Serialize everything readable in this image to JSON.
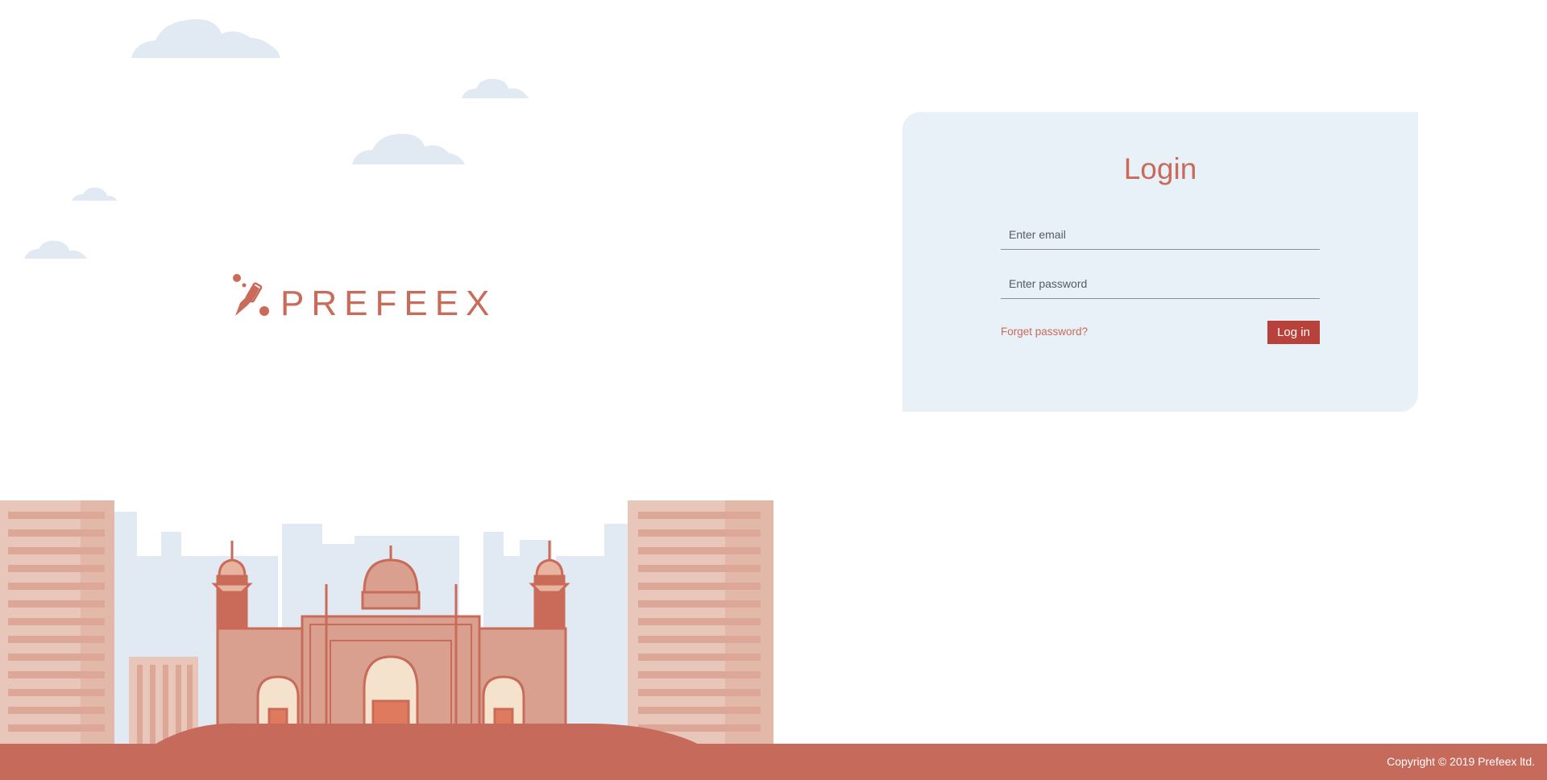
{
  "brand": {
    "name": "PREFEEX",
    "color": "#c96b58"
  },
  "login": {
    "title": "Login",
    "email_placeholder": "Enter email",
    "password_placeholder": "Enter password",
    "forgot_label": "Forget password?",
    "submit_label": "Log in"
  },
  "footer": {
    "copyright": "Copyright © 2019 Prefeex ltd."
  },
  "colors": {
    "card_bg": "#e8f0f8",
    "button_bg": "#b8413b",
    "footer_bg": "#c66a5b",
    "cloud": "#e1e9f2"
  }
}
